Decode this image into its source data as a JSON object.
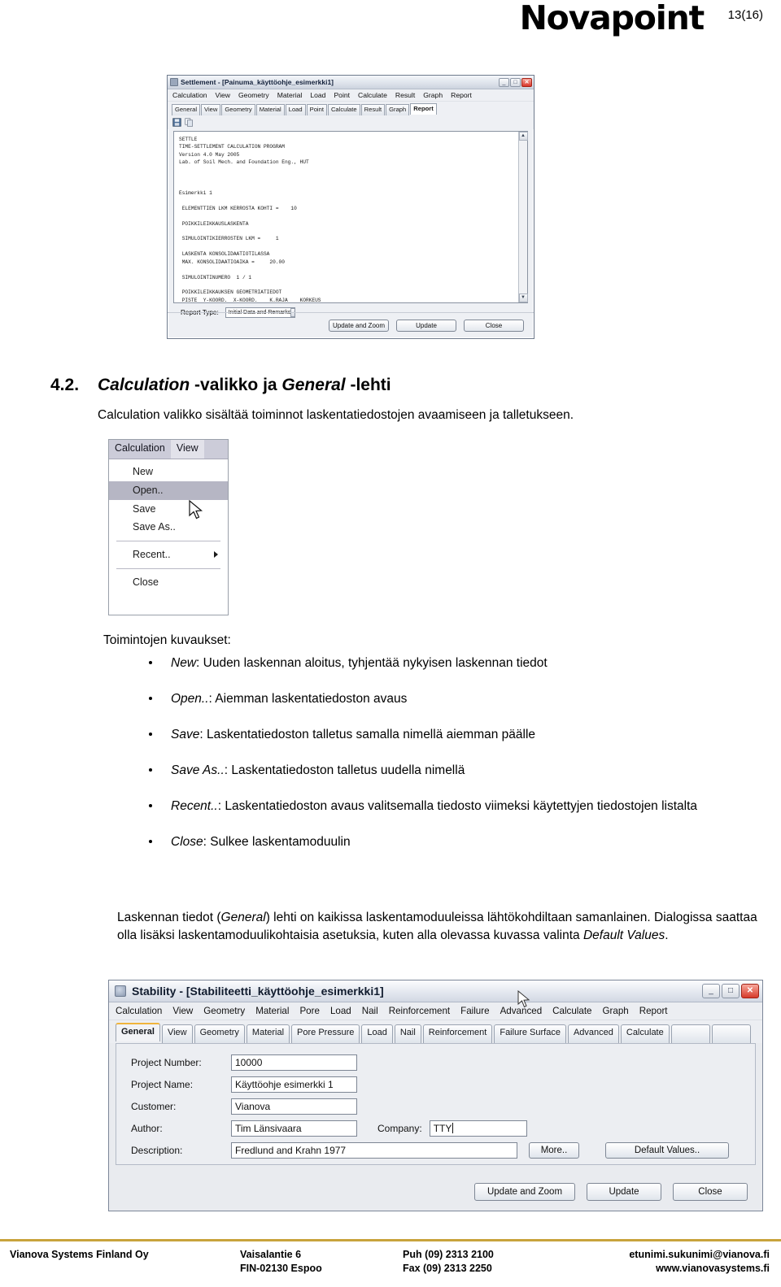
{
  "header": {
    "logo": "Novapoint",
    "page_number": "13(16)"
  },
  "figure_settlement": {
    "title": "Settlement - [Painuma_käyttöohje_esimerkki1]",
    "window_buttons": {
      "minimize": "_",
      "maximize": "□",
      "close": "✕"
    },
    "menus": [
      "Calculation",
      "View",
      "Geometry",
      "Material",
      "Load",
      "Point",
      "Calculate",
      "Result",
      "Graph",
      "Report"
    ],
    "tabs": [
      "General",
      "View",
      "Geometry",
      "Material",
      "Load",
      "Point",
      "Calculate",
      "Result",
      "Graph",
      "Report"
    ],
    "active_tab": "Report",
    "toolbar_icons": [
      "save-icon",
      "copy-icon"
    ],
    "report_text": "SETTLE\nTIME-SETTLEMENT CALCULATION PROGRAM\nVersion 4.0 May 2005\nLab. of Soil Mech. and Foundation Eng., HUT\n\n\n\nEsimerkki 1\n\n ELEMENTTIEN LKM KERROSTA KOHTI =    10\n\n POIKKILEIKKAUSLASKENTA\n\n SIMULOINTIKIERROSTEN LKM =     1\n\n LASKENTA KONSOLIDAATIOTILASSA\n MAX. KONSOLIDAATIOAIKA =     20.00\n\n SIMULOINTINUMERO  1 / 1\n\n POIKKILEIKKAUKSEN GEOMETRIATIEDOT\n PISTE  Y-KOORD.  X-KOORD.    K.RAJA    KORKEUS",
    "report_type_label": "Report Type:",
    "report_type_value": "Initial Data and Remarks",
    "buttons": {
      "update_and_zoom": "Update and Zoom",
      "update": "Update",
      "close": "Close"
    }
  },
  "section": {
    "number": "4.2.",
    "title_italic_1": "Calculation",
    "title_plain_1": " -valikko ja ",
    "title_italic_2": "General",
    "title_plain_2": " -lehti",
    "intro": "Calculation valikko sisältää toiminnot laskentatiedostojen avaamiseen ja talletukseen."
  },
  "figure_menu": {
    "menubar": [
      "Calculation",
      "View"
    ],
    "items": [
      {
        "label": "New",
        "highlighted": false,
        "submenu": false
      },
      {
        "label": "Open..",
        "highlighted": true,
        "submenu": false
      },
      {
        "label": "Save",
        "highlighted": false,
        "submenu": false
      },
      {
        "label": "Save As..",
        "highlighted": false,
        "submenu": false
      },
      {
        "label": "Recent..",
        "highlighted": false,
        "submenu": true
      },
      {
        "label": "Close",
        "highlighted": false,
        "submenu": false
      }
    ]
  },
  "descriptions": {
    "lead": "Toimintojen kuvaukset:",
    "items": [
      {
        "term": "New",
        "text": ": Uuden laskennan aloitus, tyhjentää nykyisen laskennan tiedot"
      },
      {
        "term": "Open..",
        "text": ": Aiemman laskentatiedoston avaus"
      },
      {
        "term": "Save",
        "text": ": Laskentatiedoston talletus samalla nimellä aiemman päälle"
      },
      {
        "term": "Save As..",
        "text": ": Laskentatiedoston talletus uudella nimellä"
      },
      {
        "term": "Recent..",
        "text": ": Laskentatiedoston avaus valitsemalla tiedosto viimeksi käytettyjen tiedostojen listalta"
      },
      {
        "term": "Close",
        "text": ": Sulkee laskentamoduulin"
      }
    ]
  },
  "tail_paragraph": {
    "p1": "Laskennan tiedot (",
    "i1": "General",
    "p2": ") lehti on kaikissa laskentamoduuleissa lähtökohdiltaan samanlainen. Dialogissa saattaa olla lisäksi laskentamoduulikohtaisia asetuksia, kuten alla olevassa kuvassa valinta ",
    "i2": "Default Values",
    "p3": "."
  },
  "figure_stability": {
    "title": "Stability - [Stabiliteetti_käyttöohje_esimerkki1]",
    "window_buttons": {
      "minimize": "_",
      "maximize": "□",
      "close": "✕"
    },
    "menus": [
      "Calculation",
      "View",
      "Geometry",
      "Material",
      "Pore",
      "Load",
      "Nail",
      "Reinforcement",
      "Failure",
      "Advanced",
      "Calculate",
      "Graph",
      "Report"
    ],
    "tabs": [
      "General",
      "View",
      "Geometry",
      "Material",
      "Pore Pressure",
      "Load",
      "Nail",
      "Reinforcement",
      "Failure Surface",
      "Advanced",
      "Calculate"
    ],
    "active_tab": "General",
    "blank_tabs": 2,
    "fields": [
      {
        "label": "Project Number:",
        "value": "10000"
      },
      {
        "label": "Project Name:",
        "value": "Käyttöohje esimerkki 1"
      },
      {
        "label": "Customer:",
        "value": "Vianova"
      },
      {
        "label": "Author:",
        "value": "Tim Länsivaara"
      },
      {
        "label": "Company:",
        "value": "TTY"
      },
      {
        "label": "Description:",
        "value": "Fredlund and Krahn 1977"
      }
    ],
    "buttons": {
      "more": "More..",
      "default_values": "Default Values..",
      "update_and_zoom": "Update and Zoom",
      "update": "Update",
      "close": "Close"
    }
  },
  "footer": {
    "company": "Vianova Systems Finland Oy",
    "address_line1": "Vaisalantie 6",
    "address_line2": "FIN-02130 Espoo",
    "phone_line1": "Puh  (09) 2313 2100",
    "phone_line2": "Fax  (09) 2313 2250",
    "email": "etunimi.sukunimi@vianova.fi",
    "web": "www.vianovasystems.fi"
  },
  "colors": {
    "footer_rule": "#c8a33c",
    "menu_highlight": "#b6b6c4",
    "active_tab_accent": "#f0b43c",
    "close_button": "#d63a2a"
  }
}
